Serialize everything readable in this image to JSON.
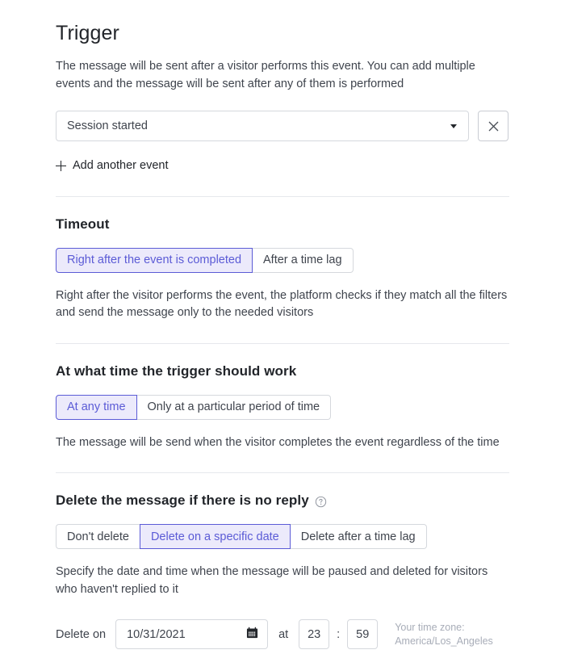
{
  "page": {
    "title": "Trigger",
    "intro": "The message will be sent after a visitor performs this event. You can add multiple events and the message will be sent after any of them is performed"
  },
  "trigger": {
    "event_select": {
      "value": "Session started",
      "caret_icon": "chevron-down-icon"
    },
    "remove_icon": "close-icon",
    "add_event_label": "Add another event",
    "add_event_icon": "plus-icon"
  },
  "timeout": {
    "heading": "Timeout",
    "options": [
      {
        "label": "Right after the event is completed",
        "selected": true
      },
      {
        "label": "After a time lag",
        "selected": false
      }
    ],
    "description": "Right after the visitor performs the event, the platform checks if they match all the filters and send the message only to the needed visitors"
  },
  "trigger_time": {
    "heading": "At what time the trigger should work",
    "options": [
      {
        "label": "At any time",
        "selected": true
      },
      {
        "label": "Only at a particular period of time",
        "selected": false
      }
    ],
    "description": "The message will be send when the visitor completes the event regardless of the time"
  },
  "delete_message": {
    "heading": "Delete the message if there is no reply",
    "help_icon": "help-circle-icon",
    "options": [
      {
        "label": "Don't delete",
        "selected": false
      },
      {
        "label": "Delete on a specific date",
        "selected": true
      },
      {
        "label": "Delete after a time lag",
        "selected": false
      }
    ],
    "description": "Specify the date and time when the message will be paused and deleted for visitors who haven't replied to it",
    "delete_on_label": "Delete on",
    "date_value": "10/31/2021",
    "calendar_icon": "calendar-icon",
    "at_label": "at",
    "hours_value": "23",
    "separator": ":",
    "minutes_value": "59",
    "timezone_label": "Your time zone:",
    "timezone_value": "America/Los_Angeles"
  },
  "colors": {
    "accent": "#5b5bd6",
    "accent_bg": "#eceafb",
    "border": "#d5d8dd",
    "text": "#3f444d",
    "muted": "#a8adb8"
  }
}
